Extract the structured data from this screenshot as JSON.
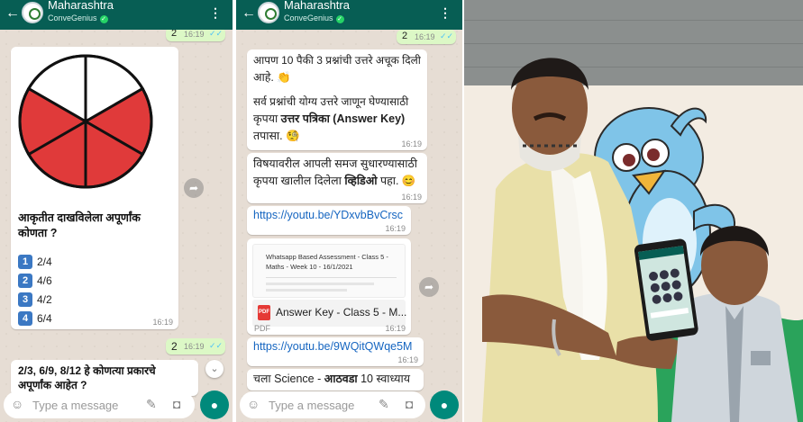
{
  "common": {
    "contact_name": "Maharashtra",
    "contact_sub": "ConveGenius",
    "input_placeholder": "Type a message"
  },
  "chat1": {
    "prev_reply": "2",
    "prev_time": "16:19",
    "question": "आकृतीत दाखविलेला अपूर्णांक कोणता ?",
    "options": [
      {
        "num": "1",
        "text": "2/4"
      },
      {
        "num": "2",
        "text": "4/6"
      },
      {
        "num": "3",
        "text": "4/2"
      },
      {
        "num": "4",
        "text": "6/4"
      }
    ],
    "question_time": "16:19",
    "reply": "2",
    "reply_time": "16:19",
    "next_question_line1": "2/3, 6/9, 8/12 हे कोणत्या प्रकारचे",
    "next_question_line2": "अपूर्णांक आहेत ?",
    "pie_colors": {
      "red": "#e03a3a",
      "white": "#ffffff"
    }
  },
  "chat2": {
    "prev_reply": "2",
    "prev_time": "16:19",
    "msg1_line1": "आपण 10 पैकी 3 प्रश्नांची उत्तरे अचूक दिली",
    "msg1_line2": "आहे. 👏",
    "msg1_line3": "सर्व प्रश्नांची योग्य उत्तरे जाणून घेण्यासाठी",
    "msg1_line4a": "कृपया ",
    "msg1_line4b": "उत्तर पत्रिका",
    "msg1_line4c": " (Answer Key)",
    "msg1_line5": "तपासा. 🧐",
    "msg1_time": "16:19",
    "msg2_line1": "विषयावरील आपली समज सुधारण्यासाठी",
    "msg2_line2a": "कृपया खालील दिलेला ",
    "msg2_line2b": "व्हिडिओ",
    "msg2_line2c": " पहा. 😊",
    "msg2_time": "16:19",
    "link1": "https://youtu.be/YDxvbBvCrsc",
    "link1_time": "16:19",
    "doc_preview_title": "Whatsapp Based Assessment - Class 5 - Maths - Week 10 - 16/1/2021",
    "doc_name": "Answer Key - Class 5 - M...",
    "doc_type": "PDF",
    "doc_time": "16:19",
    "link2": "https://youtu.be/9WQitQWqe5M",
    "link2_time": "16:19",
    "next_line_a": "चला Science - ",
    "next_line_b": "आठवडा",
    "next_line_c": " 10 स्वाध्याय"
  }
}
